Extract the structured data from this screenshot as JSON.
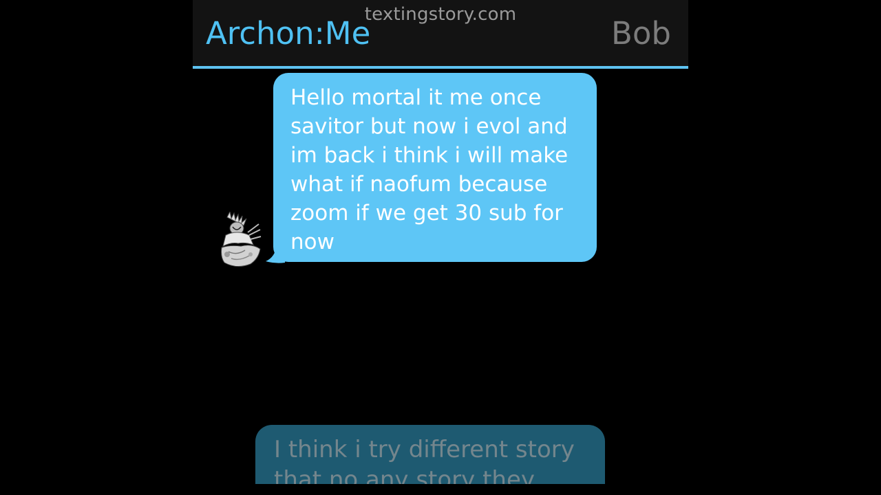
{
  "app": {
    "watermark": "textingstory.com"
  },
  "header": {
    "contact_name": "Archon:Me",
    "right_name": "Bob"
  },
  "messages": [
    {
      "text": "Hello mortal it me once\nsavitor but now i evol and\nim back i think i will make\nwhat if naofum because\nzoom if we get 30 sub for\nnow",
      "avatar_icon": "warrior-avatar-icon"
    }
  ],
  "incoming_preview": {
    "text": "I think i try different story\nthat no any story they"
  },
  "colors": {
    "accent": "#5ec3f2",
    "bubble": "#5ec6f6",
    "header_bg": "#131313",
    "faded_bubble": "#1e5a71"
  }
}
